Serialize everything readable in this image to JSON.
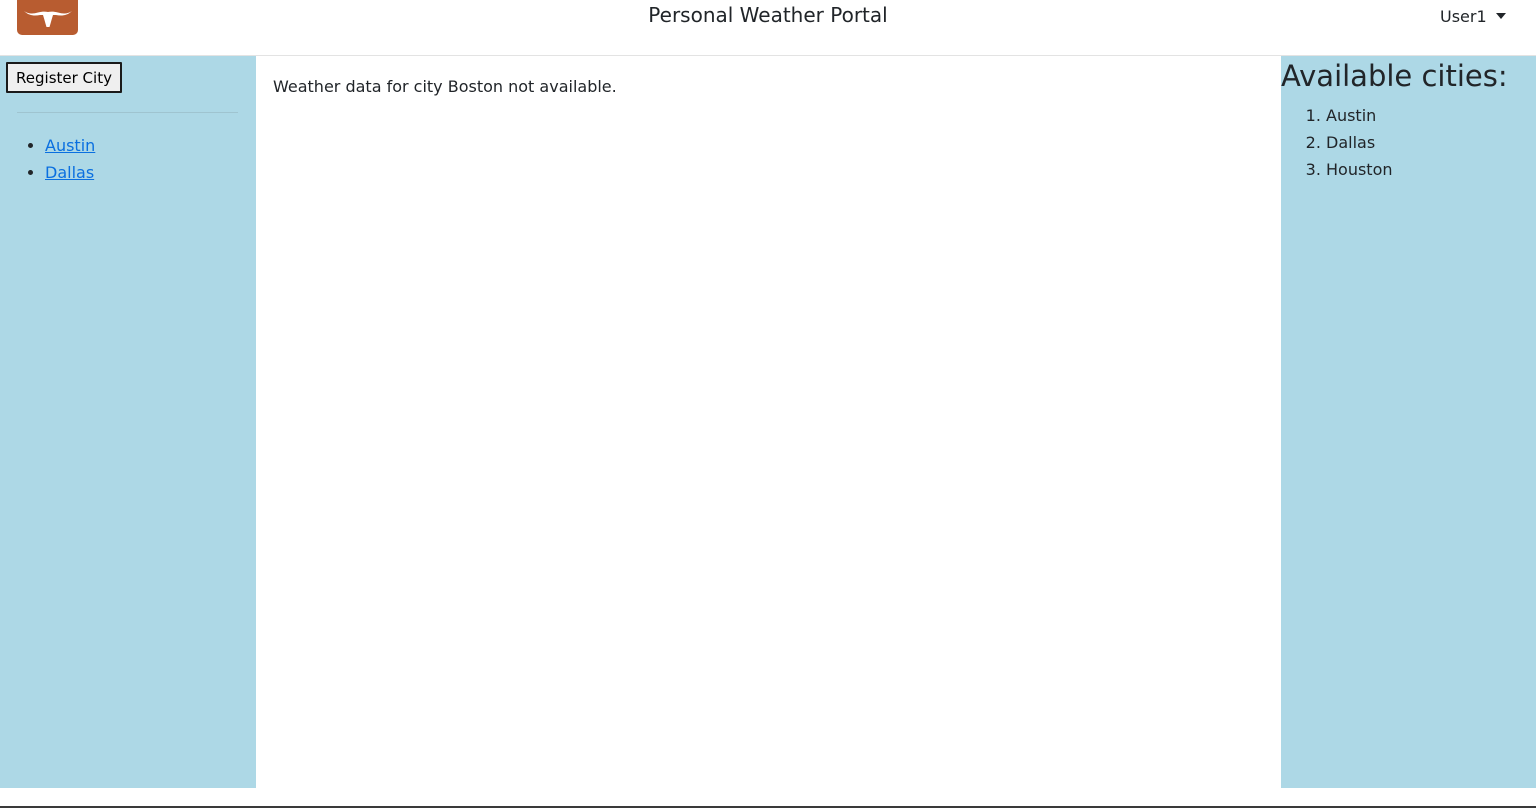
{
  "header": {
    "logo_icon": "longhorn-icon",
    "title": "Personal Weather Portal",
    "user_label": "User1"
  },
  "sidebar": {
    "register_button_label": "Register City",
    "links": [
      "Austin",
      "Dallas"
    ]
  },
  "main": {
    "message": "Weather data for city Boston not available."
  },
  "available": {
    "heading": "Available cities:",
    "cities": [
      "Austin",
      "Dallas",
      "Houston"
    ]
  },
  "colors": {
    "sidebar_bg": "#add8e6",
    "logo_bg": "#bf5700",
    "link": "#0a6fe0"
  }
}
